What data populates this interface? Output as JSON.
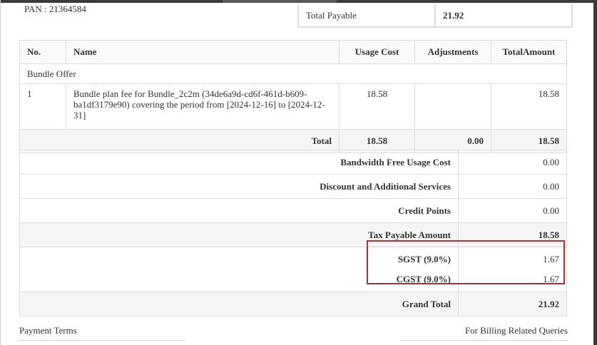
{
  "header": {
    "pan_label": "PAN : 21364584"
  },
  "payable": {
    "label": "Total Payable",
    "value": "21.92"
  },
  "items": {
    "columns": [
      "No.",
      "Name",
      "Usage Cost",
      "Adjustments",
      "TotalAmount"
    ],
    "group_title": "Bundle Offer",
    "rows": [
      {
        "no": "1",
        "name": "Bundle plan fee for Bundle_2c2m (34de6a9d-cd6f-461d-b609-ba1df3179e90) covering the period from [2024-12-16] to [2024-12-31]",
        "usage_cost": "18.58",
        "adjustments": "",
        "total_amount": "18.58"
      }
    ],
    "total": {
      "label": "Total",
      "usage_cost": "18.58",
      "adjustments": "0.00",
      "total_amount": "18.58"
    }
  },
  "summary": {
    "bandwidth": {
      "label": "Bandwidth Free Usage Cost",
      "value": "0.00"
    },
    "discount": {
      "label": "Discount and Additional Services",
      "value": "0.00"
    },
    "credit": {
      "label": "Credit Points",
      "value": "0.00"
    },
    "tax_payable": {
      "label": "Tax Payable Amount",
      "value": "18.58"
    },
    "sgst": {
      "label": "SGST (9.0%)",
      "value": "1.67"
    },
    "cgst": {
      "label": "CGST (9.0%)",
      "value": "1.67"
    },
    "grand_total": {
      "label": "Grand Total",
      "value": "21.92"
    }
  },
  "footer": {
    "payment_terms": "Payment Terms",
    "billing_queries": "For Billing Related Queries"
  },
  "colors": {
    "highlight": "#b03030",
    "border": "#dddddd",
    "shade": "#f5f5f5"
  }
}
